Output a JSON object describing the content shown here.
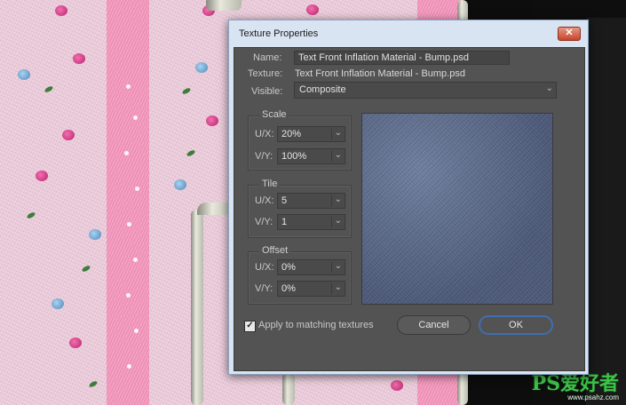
{
  "dialog": {
    "title": "Texture Properties",
    "close_glyph": "✕",
    "name_label": "Name:",
    "name_value": "Text Front Inflation Material - Bump.psd",
    "texture_label": "Texture:",
    "texture_value": "Text Front Inflation Material - Bump.psd",
    "visible_label": "Visible:",
    "visible_value": "Composite",
    "scale": {
      "title": "Scale",
      "ux_label": "U/X:",
      "ux_value": "20%",
      "vy_label": "V/Y:",
      "vy_value": "100%"
    },
    "tile": {
      "title": "Tile",
      "ux_label": "U/X:",
      "ux_value": "5",
      "vy_label": "V/Y:",
      "vy_value": "1"
    },
    "offset": {
      "title": "Offset",
      "ux_label": "U/X:",
      "ux_value": "0%",
      "vy_label": "V/Y:",
      "vy_value": "0%"
    },
    "apply_label": "Apply to matching textures",
    "apply_checked": true,
    "cancel_label": "Cancel",
    "ok_label": "OK",
    "chevron_glyph": "⌄"
  },
  "watermark": {
    "main": "PS爱好者",
    "sub": "www.psahz.com"
  },
  "colors": {
    "accent": "#3e6fb0",
    "panel": "#535353",
    "close": "#c9442a"
  }
}
